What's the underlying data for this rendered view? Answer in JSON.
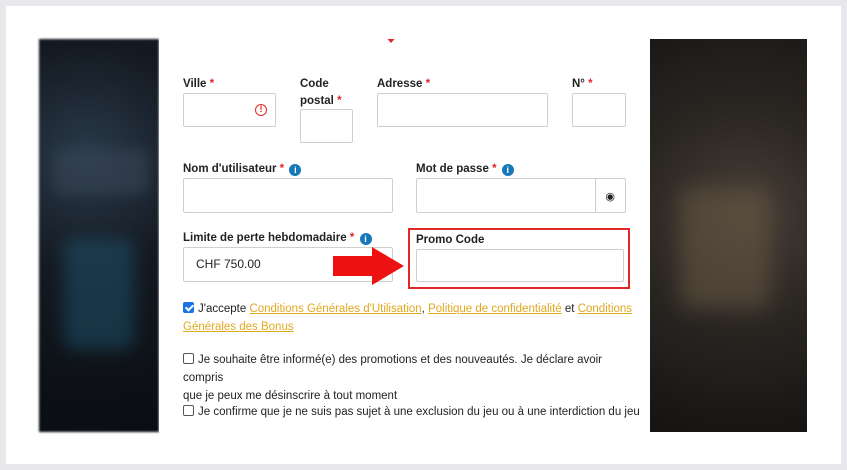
{
  "colors": {
    "accent": "#e32626",
    "link": "#e0a81e",
    "info": "#1677b9",
    "checkbox": "#1a73e8"
  },
  "form": {
    "ville": {
      "label": "Ville",
      "required": "*"
    },
    "code_postal": {
      "label_line1": "Code",
      "label_line2": "postal",
      "required": "*"
    },
    "adresse": {
      "label": "Adresse",
      "required": "*"
    },
    "numero": {
      "label": "N°",
      "required": "*"
    },
    "username": {
      "label": "Nom d'utilisateur",
      "required": "*"
    },
    "password": {
      "label": "Mot de passe",
      "required": "*"
    },
    "limit": {
      "label": "Limite de perte hebdomadaire",
      "required": "*",
      "value": "CHF 750.00"
    },
    "promo": {
      "label": "Promo Code",
      "value": ""
    }
  },
  "consents": {
    "terms": {
      "checked": true,
      "prefix": "J'accepte",
      "link1": "Conditions Générales d'Utilisation",
      "sep": ",",
      "link2": "Politique de confidentialité",
      "mid": "et",
      "link3a": "Conditions",
      "link3b": "Générales des Bonus"
    },
    "promotions": {
      "checked": false,
      "line1": "Je souhaite être informé(e) des promotions et des nouveautés. Je déclare avoir compris",
      "line2": "que je peux me désinscrire à tout moment"
    },
    "exclusion": {
      "checked": false,
      "text": "Je confirme que je ne suis pas sujet à une exclusion du jeu ou à une interdiction du jeu"
    }
  },
  "icons": {
    "info": "info-icon",
    "error": "error-icon",
    "eye": "eye-icon",
    "arrow": "arrow-right-icon"
  }
}
